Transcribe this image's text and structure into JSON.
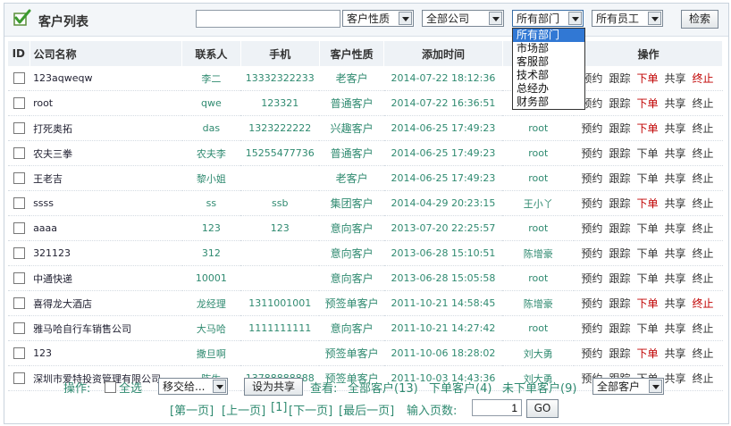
{
  "header": {
    "title": "客户列表",
    "search_value": "",
    "filters": {
      "nature": "客户性质",
      "company": "全部公司",
      "department": "所有部门",
      "staff": "所有员工"
    },
    "search_button": "检索"
  },
  "department_dropdown": {
    "options": [
      "所有部门",
      "市场部",
      "客服部",
      "技术部",
      "总经办",
      "财务部"
    ],
    "selected_index": 0
  },
  "table": {
    "columns": {
      "id": "ID",
      "company": "公司名称",
      "contact": "联系人",
      "phone": "手机",
      "nature": "客户性质",
      "added": "添加时间",
      "owner": "",
      "ops": "操作"
    },
    "actions": [
      "预约",
      "跟踪",
      "下单",
      "共享",
      "终止"
    ],
    "rows": [
      {
        "company": "123aqweqw",
        "contact": "李二",
        "phone": "13332322233",
        "nature": "老客户",
        "added": "2014-07-22 18:12:36",
        "owner": "",
        "order_red": true,
        "stop_red": true
      },
      {
        "company": "root",
        "contact": "qwe",
        "phone": "123321",
        "nature": "普通客户",
        "added": "2014-07-22 16:36:51",
        "owner": "",
        "order_red": true,
        "stop_red": false
      },
      {
        "company": "打死奥拓",
        "contact": "das",
        "phone": "1323222222",
        "nature": "兴趣客户",
        "added": "2014-06-25 17:49:23",
        "owner": "root",
        "order_red": true,
        "stop_red": false
      },
      {
        "company": "农夫三拳",
        "contact": "农夫李",
        "phone": "15255477736",
        "nature": "普通客户",
        "added": "2014-06-25 17:49:23",
        "owner": "root",
        "order_red": false,
        "stop_red": false
      },
      {
        "company": "王老吉",
        "contact": "黎小姐",
        "phone": "",
        "nature": "老客户",
        "added": "2014-06-25 17:49:23",
        "owner": "root",
        "order_red": false,
        "stop_red": false
      },
      {
        "company": "ssss",
        "contact": "ss",
        "phone": "ssb",
        "nature": "集团客户",
        "added": "2014-04-29 20:23:15",
        "owner": "王小丫",
        "order_red": true,
        "stop_red": false
      },
      {
        "company": "aaaa",
        "contact": "123",
        "phone": "123",
        "nature": "意向客户",
        "added": "2013-07-20 22:25:57",
        "owner": "root",
        "order_red": false,
        "stop_red": false
      },
      {
        "company": "321123",
        "contact": "312",
        "phone": "",
        "nature": "意向客户",
        "added": "2013-06-28 15:10:51",
        "owner": "陈增豪",
        "order_red": false,
        "stop_red": false
      },
      {
        "company": "中通快递",
        "contact": "10001",
        "phone": "",
        "nature": "意向客户",
        "added": "2013-06-28 15:05:58",
        "owner": "root",
        "order_red": false,
        "stop_red": false
      },
      {
        "company": "喜得龙大酒店",
        "contact": "龙经理",
        "phone": "1311001001",
        "nature": "预签单客户",
        "added": "2011-10-21 14:58:45",
        "owner": "陈增豪",
        "order_red": true,
        "stop_red": true
      },
      {
        "company": "雅马哈自行车销售公司",
        "contact": "大马哈",
        "phone": "1111111111",
        "nature": "意向客户",
        "added": "2011-10-21 14:27:42",
        "owner": "root",
        "order_red": false,
        "stop_red": false
      },
      {
        "company": "123",
        "contact": "撒旦啊",
        "phone": "",
        "nature": "预签单客户",
        "added": "2011-10-06 18:28:02",
        "owner": "刘大勇",
        "order_red": true,
        "stop_red": false
      },
      {
        "company": "深圳市爱特投资管理有限公司",
        "contact": "陈生",
        "phone": "13788888888",
        "nature": "预签单客户",
        "added": "2011-10-03 14:43:36",
        "owner": "刘大勇",
        "order_red": false,
        "stop_red": false
      }
    ]
  },
  "footer": {
    "ops_label": "操作:",
    "select_all": "全选",
    "move_select": "移交给...",
    "share_button": "设为共享",
    "view_label": "查看:",
    "all_customers": "全部客户(13)",
    "ordered": "下单客户(4)",
    "not_ordered": "未下单客户(9)",
    "view_select": "全部客户",
    "first_page": "[第一页]",
    "prev_page": "[上一页]",
    "page_num": "[1]",
    "next_page": "[下一页]",
    "last_page": "[最后一页]",
    "page_input_label": "输入页数:",
    "page_input_value": "1",
    "go_button": "GO"
  },
  "colors": {
    "green_text": "#2f8a70",
    "red_text": "#c00000",
    "dropdown_highlight": "#3178d4"
  }
}
